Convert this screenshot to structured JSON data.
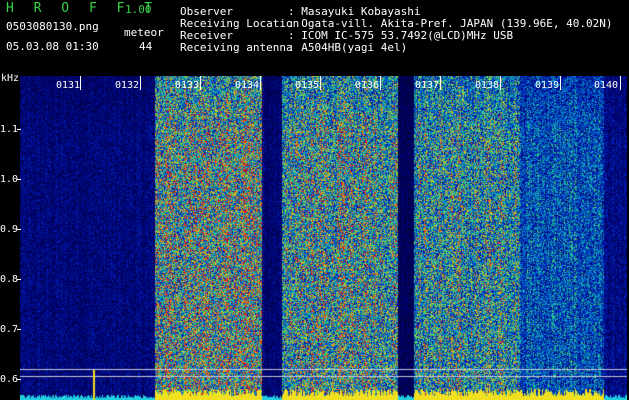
{
  "app": {
    "title": "H R O F F T",
    "version": "1.00",
    "filename": "0503080130.png",
    "datetime": "05.03.08 01:30",
    "meteor_label": "meteor",
    "meteor_count": "44"
  },
  "info": [
    {
      "label": "Observer",
      "value": ": Masayuki Kobayashi"
    },
    {
      "label": "Receiving Location",
      "value": ": Ogata-vill. Akita-Pref. JAPAN (139.96E, 40.02N)"
    },
    {
      "label": "Receiver",
      "value": ": ICOM IC-575 53.7492(@LCD)MHz USB"
    },
    {
      "label": "Receiving antenna",
      "value": ": A504HB(yagi 4el)"
    }
  ],
  "axis": {
    "y_unit": "kHz",
    "y_ticks": [
      "1.1",
      "1.0",
      "0.9",
      "0.8",
      "0.7",
      "0.6"
    ],
    "x_ticks": [
      "0131",
      "0132",
      "0133",
      "0134",
      "0135",
      "0136",
      "0137",
      "0138",
      "0139",
      "0140"
    ]
  },
  "colors": {
    "background": "#000000",
    "title_green": "#39d24a",
    "baseline_yellow": "#f0e020",
    "baseline_cyan": "#20d0e0"
  }
}
